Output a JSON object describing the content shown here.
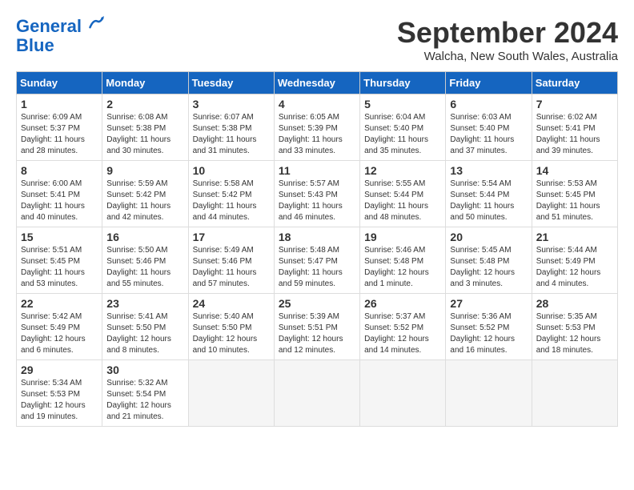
{
  "header": {
    "logo_line1": "General",
    "logo_line2": "Blue",
    "month": "September 2024",
    "location": "Walcha, New South Wales, Australia"
  },
  "columns": [
    "Sunday",
    "Monday",
    "Tuesday",
    "Wednesday",
    "Thursday",
    "Friday",
    "Saturday"
  ],
  "weeks": [
    {
      "row_class": "row-odd",
      "days": [
        {
          "num": "1",
          "rise": "6:09 AM",
          "set": "5:37 PM",
          "daylight": "11 hours and 28 minutes."
        },
        {
          "num": "2",
          "rise": "6:08 AM",
          "set": "5:38 PM",
          "daylight": "11 hours and 30 minutes."
        },
        {
          "num": "3",
          "rise": "6:07 AM",
          "set": "5:38 PM",
          "daylight": "11 hours and 31 minutes."
        },
        {
          "num": "4",
          "rise": "6:05 AM",
          "set": "5:39 PM",
          "daylight": "11 hours and 33 minutes."
        },
        {
          "num": "5",
          "rise": "6:04 AM",
          "set": "5:40 PM",
          "daylight": "11 hours and 35 minutes."
        },
        {
          "num": "6",
          "rise": "6:03 AM",
          "set": "5:40 PM",
          "daylight": "11 hours and 37 minutes."
        },
        {
          "num": "7",
          "rise": "6:02 AM",
          "set": "5:41 PM",
          "daylight": "11 hours and 39 minutes."
        }
      ]
    },
    {
      "row_class": "row-even",
      "days": [
        {
          "num": "8",
          "rise": "6:00 AM",
          "set": "5:41 PM",
          "daylight": "11 hours and 40 minutes."
        },
        {
          "num": "9",
          "rise": "5:59 AM",
          "set": "5:42 PM",
          "daylight": "11 hours and 42 minutes."
        },
        {
          "num": "10",
          "rise": "5:58 AM",
          "set": "5:42 PM",
          "daylight": "11 hours and 44 minutes."
        },
        {
          "num": "11",
          "rise": "5:57 AM",
          "set": "5:43 PM",
          "daylight": "11 hours and 46 minutes."
        },
        {
          "num": "12",
          "rise": "5:55 AM",
          "set": "5:44 PM",
          "daylight": "11 hours and 48 minutes."
        },
        {
          "num": "13",
          "rise": "5:54 AM",
          "set": "5:44 PM",
          "daylight": "11 hours and 50 minutes."
        },
        {
          "num": "14",
          "rise": "5:53 AM",
          "set": "5:45 PM",
          "daylight": "11 hours and 51 minutes."
        }
      ]
    },
    {
      "row_class": "row-odd",
      "days": [
        {
          "num": "15",
          "rise": "5:51 AM",
          "set": "5:45 PM",
          "daylight": "11 hours and 53 minutes."
        },
        {
          "num": "16",
          "rise": "5:50 AM",
          "set": "5:46 PM",
          "daylight": "11 hours and 55 minutes."
        },
        {
          "num": "17",
          "rise": "5:49 AM",
          "set": "5:46 PM",
          "daylight": "11 hours and 57 minutes."
        },
        {
          "num": "18",
          "rise": "5:48 AM",
          "set": "5:47 PM",
          "daylight": "11 hours and 59 minutes."
        },
        {
          "num": "19",
          "rise": "5:46 AM",
          "set": "5:48 PM",
          "daylight": "12 hours and 1 minute."
        },
        {
          "num": "20",
          "rise": "5:45 AM",
          "set": "5:48 PM",
          "daylight": "12 hours and 3 minutes."
        },
        {
          "num": "21",
          "rise": "5:44 AM",
          "set": "5:49 PM",
          "daylight": "12 hours and 4 minutes."
        }
      ]
    },
    {
      "row_class": "row-even",
      "days": [
        {
          "num": "22",
          "rise": "5:42 AM",
          "set": "5:49 PM",
          "daylight": "12 hours and 6 minutes."
        },
        {
          "num": "23",
          "rise": "5:41 AM",
          "set": "5:50 PM",
          "daylight": "12 hours and 8 minutes."
        },
        {
          "num": "24",
          "rise": "5:40 AM",
          "set": "5:50 PM",
          "daylight": "12 hours and 10 minutes."
        },
        {
          "num": "25",
          "rise": "5:39 AM",
          "set": "5:51 PM",
          "daylight": "12 hours and 12 minutes."
        },
        {
          "num": "26",
          "rise": "5:37 AM",
          "set": "5:52 PM",
          "daylight": "12 hours and 14 minutes."
        },
        {
          "num": "27",
          "rise": "5:36 AM",
          "set": "5:52 PM",
          "daylight": "12 hours and 16 minutes."
        },
        {
          "num": "28",
          "rise": "5:35 AM",
          "set": "5:53 PM",
          "daylight": "12 hours and 18 minutes."
        }
      ]
    },
    {
      "row_class": "row-odd",
      "days": [
        {
          "num": "29",
          "rise": "5:34 AM",
          "set": "5:53 PM",
          "daylight": "12 hours and 19 minutes."
        },
        {
          "num": "30",
          "rise": "5:32 AM",
          "set": "5:54 PM",
          "daylight": "12 hours and 21 minutes."
        },
        null,
        null,
        null,
        null,
        null
      ]
    }
  ],
  "labels": {
    "sunrise": "Sunrise:",
    "sunset": "Sunset:",
    "daylight": "Daylight:"
  }
}
